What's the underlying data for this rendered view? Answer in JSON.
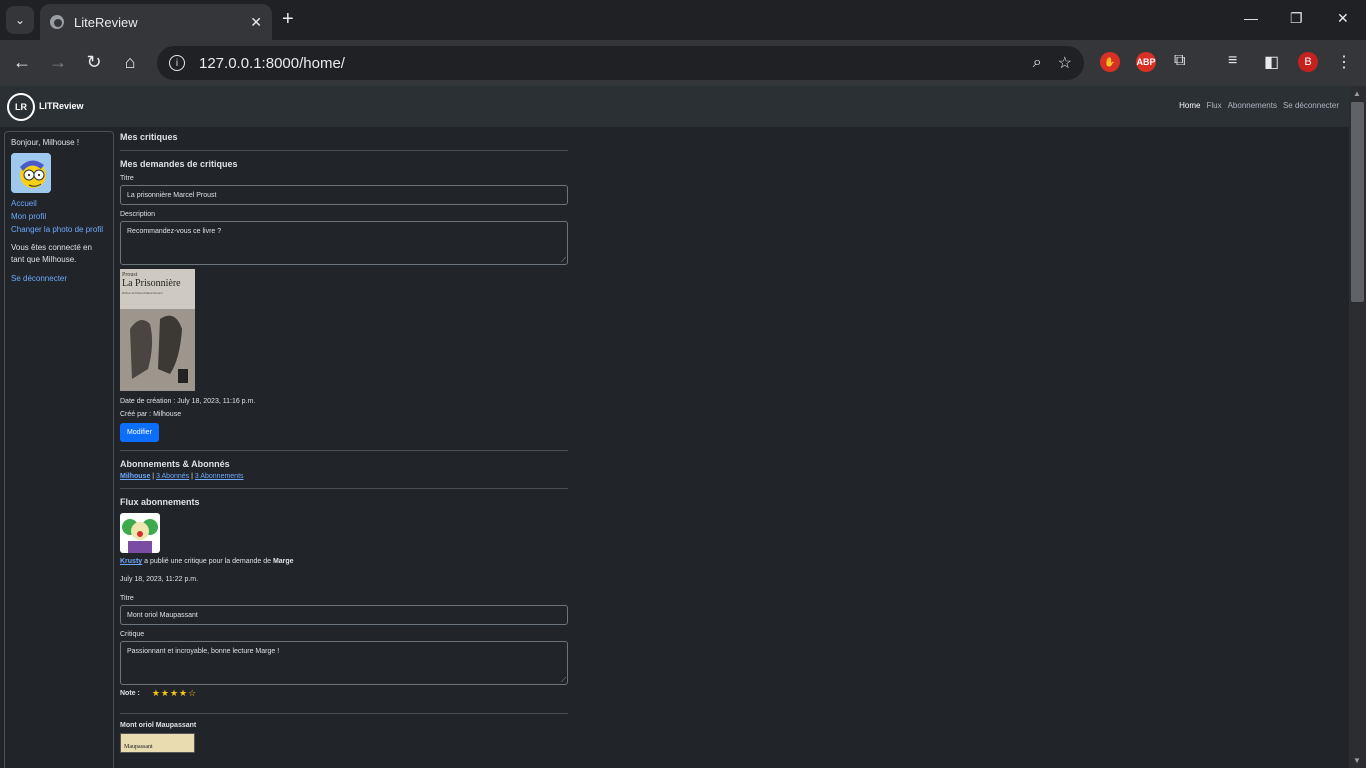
{
  "browser": {
    "tab_title": "LiteReview",
    "url": "127.0.0.1:8000/home/",
    "profile_initial": "B",
    "ext_abp": "ABP"
  },
  "site": {
    "brand": "LITReview",
    "nav": [
      "Home",
      "Flux",
      "Abonnements",
      "Se déconnecter"
    ]
  },
  "sidebar": {
    "greeting": "Bonjour, Milhouse !",
    "links": [
      "Accueil",
      "Mon profil",
      "Changer la photo de profil"
    ],
    "connected_text": "Vous êtes connecté en tant que Milhouse.",
    "logout": "Se déconnecter"
  },
  "main": {
    "my_reviews_title": "Mes critiques",
    "my_requests_title": "Mes demandes de critiques",
    "ticket": {
      "title_label": "Titre",
      "title_value": "La prisonnière Marcel Proust",
      "desc_label": "Description",
      "desc_value": "Recommandez-vous ce livre ?",
      "cover_author": "Proust",
      "cover_title": "La Prisonnière",
      "cover_preface": "Préface de Pierre-Edmond Robert",
      "created_at": "Date de création : July 18, 2023, 11:16 p.m.",
      "created_by": "Créé par : Milhouse",
      "edit_button": "Modifier"
    },
    "follows_title": "Abonnements & Abonnés",
    "follows": {
      "user": "Milhouse",
      "sep1": " | ",
      "followers": "3 Abonnés",
      "sep2": " | ",
      "following": "3 Abonnements"
    },
    "feed_title": "Flux abonnements",
    "feed_post": {
      "author": "Krusty",
      "action_text": " a publié une critique pour la demande de ",
      "target_user": "Marge",
      "date": "July 18, 2023, 11:22 p.m.",
      "title_label": "Titre",
      "title_value": "Mont oriol Maupassant",
      "critique_label": "Critique",
      "critique_value": "Passionnant et incroyable, bonne lecture Marge !",
      "note_label": "Note :",
      "rating": 4,
      "rating_max": 5,
      "stars_text": "★★★★☆"
    },
    "next_title": "Mont oriol Maupassant",
    "next_cover_text": "Maupassant"
  }
}
